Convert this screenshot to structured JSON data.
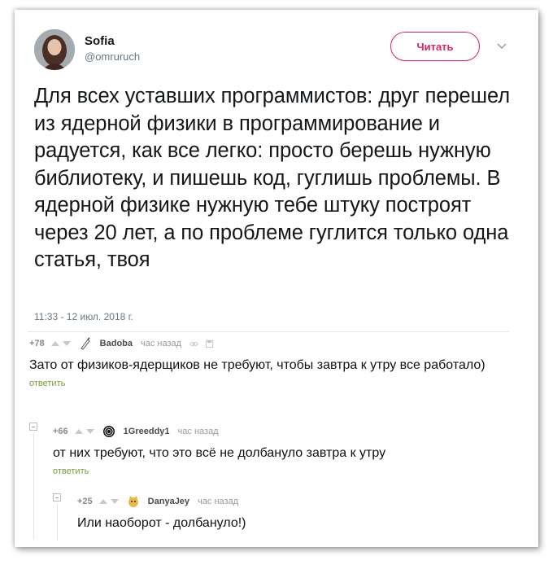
{
  "tweet": {
    "name": "Sofia",
    "handle": "@omruruch",
    "follow_label": "Читать",
    "text": "Для всех уставших программистов: друг перешел из ядерной физики в программирование и радуется, как все легко: просто берешь нужную библиотеку, и пишешь код, гуглишь проблемы. В ядерной физике нужную тебе штуку построят через 20 лет, а по проблеме гуглится только одна статья, твоя",
    "timestamp": "11:33 - 12 июл. 2018 г.",
    "colors": {
      "accent": "#e0245e",
      "handle": "#657786"
    }
  },
  "comments": [
    {
      "rating": "+78",
      "user": "Badoba",
      "time": "час назад",
      "text": "Зато от физиков-ядерщиков не требуют, чтобы завтра к утру все работало)",
      "reply_label": "ответить",
      "avatar_icon": "pen-avatar-icon"
    },
    {
      "rating": "+66",
      "user": "1Greeddy1",
      "time": "час назад",
      "text": "от них требуют, что это всё не долбануло завтра к утру",
      "reply_label": "ответить",
      "avatar_icon": "spiral-avatar-icon"
    },
    {
      "rating": "+25",
      "user": "DanyaJey",
      "time": "час назад",
      "text": "Или наоборот - долбануло!)",
      "avatar_icon": "cat-avatar-icon"
    }
  ],
  "colors": {
    "reply_link": "#7a9a3a",
    "meta": "#9a9a9a"
  }
}
